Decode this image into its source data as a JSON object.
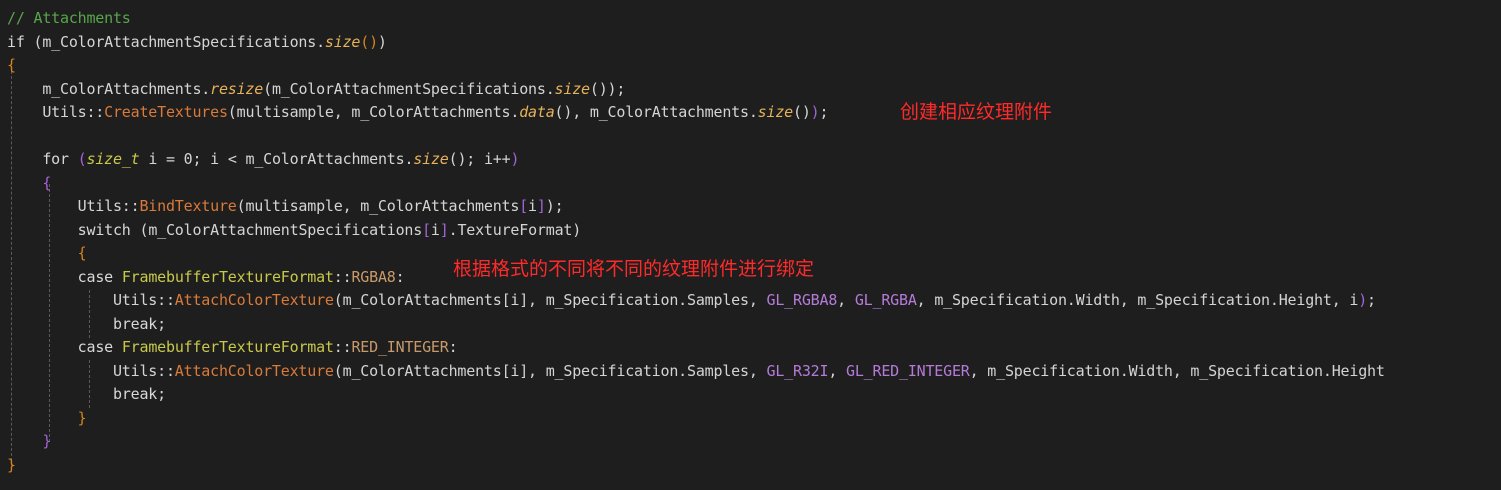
{
  "colors": {
    "background": "#1e1e1e",
    "text": "#d4d4d4",
    "comment": "#57a64a",
    "keyword": "#d8d8d8",
    "method": "#e8b25a",
    "function": "#d97a3a",
    "type": "#c8c84a",
    "macro": "#b57bd9",
    "enum_member": "#c89a6a",
    "bracket_purple": "#a463d6",
    "bracket_orange": "#d2851f",
    "annotation": "#ff2a2a",
    "guide": "#5a5a5a"
  },
  "code_lines": [
    [
      {
        "t": "// Attachments",
        "c": "comment"
      }
    ],
    [
      {
        "t": "if ",
        "c": "keyword"
      },
      {
        "t": "(m_ColorAttachmentSpecifications."
      },
      {
        "t": "size",
        "c": "method",
        "i": true
      },
      {
        "t": "()",
        "c": "bracket_orange"
      },
      {
        "t": ")"
      }
    ],
    [
      {
        "t": "{",
        "c": "bracket_orange"
      }
    ],
    [
      {
        "t": "    m_ColorAttachments."
      },
      {
        "t": "resize",
        "c": "method",
        "i": true
      },
      {
        "t": "("
      },
      {
        "t": "m_ColorAttachmentSpecifications."
      },
      {
        "t": "size",
        "c": "method",
        "i": true
      },
      {
        "t": "()"
      },
      {
        "t": ");"
      }
    ],
    [
      {
        "t": "    Utils::"
      },
      {
        "t": "CreateTextures",
        "c": "function"
      },
      {
        "t": "("
      },
      {
        "t": "multisample, m_ColorAttachments."
      },
      {
        "t": "data",
        "c": "method",
        "i": true
      },
      {
        "t": "()"
      },
      {
        "t": ", m_ColorAttachments."
      },
      {
        "t": "size",
        "c": "method",
        "i": true
      },
      {
        "t": "()"
      },
      {
        "t": ")",
        "c": "bracket_purple"
      },
      {
        "t": ";"
      }
    ],
    [],
    [
      {
        "t": "    "
      },
      {
        "t": "for",
        "c": "keyword"
      },
      {
        "t": " "
      },
      {
        "t": "(",
        "c": "bracket_purple"
      },
      {
        "t": "size_t",
        "c": "type",
        "i": true
      },
      {
        "t": " i = 0; i < m_ColorAttachments."
      },
      {
        "t": "size",
        "c": "method",
        "i": true
      },
      {
        "t": "()"
      },
      {
        "t": "; i++"
      },
      {
        "t": ")",
        "c": "bracket_purple"
      }
    ],
    [
      {
        "t": "    "
      },
      {
        "t": "{",
        "c": "bracket_purple"
      }
    ],
    [
      {
        "t": "        Utils::"
      },
      {
        "t": "BindTexture",
        "c": "function"
      },
      {
        "t": "(multisample, m_ColorAttachments"
      },
      {
        "t": "[",
        "c": "bracket_purple"
      },
      {
        "t": "i"
      },
      {
        "t": "]",
        "c": "bracket_purple"
      },
      {
        "t": ");"
      }
    ],
    [
      {
        "t": "        "
      },
      {
        "t": "switch",
        "c": "keyword"
      },
      {
        "t": " (m_ColorAttachmentSpecifications"
      },
      {
        "t": "[",
        "c": "bracket_purple"
      },
      {
        "t": "i"
      },
      {
        "t": "]",
        "c": "bracket_purple"
      },
      {
        "t": ".TextureFormat)"
      }
    ],
    [
      {
        "t": "        "
      },
      {
        "t": "{",
        "c": "bracket_orange"
      }
    ],
    [
      {
        "t": "        "
      },
      {
        "t": "case",
        "c": "keyword"
      },
      {
        "t": " "
      },
      {
        "t": "FramebufferTextureFormat",
        "c": "type"
      },
      {
        "t": "::"
      },
      {
        "t": "RGBA8",
        "c": "enum_member"
      },
      {
        "t": ":"
      }
    ],
    [
      {
        "t": "            Utils::"
      },
      {
        "t": "AttachColorTexture",
        "c": "function"
      },
      {
        "t": "("
      },
      {
        "t": "m_ColorAttachments[i], m_Specification.Samples, "
      },
      {
        "t": "GL_RGBA8",
        "c": "macro"
      },
      {
        "t": ", "
      },
      {
        "t": "GL_RGBA",
        "c": "macro"
      },
      {
        "t": ", m_Specification.Width, m_Specification.Height, i"
      },
      {
        "t": ")",
        "c": "bracket_purple"
      },
      {
        "t": ";"
      }
    ],
    [
      {
        "t": "            "
      },
      {
        "t": "break",
        "c": "keyword"
      },
      {
        "t": ";"
      }
    ],
    [
      {
        "t": "        "
      },
      {
        "t": "case",
        "c": "keyword"
      },
      {
        "t": " "
      },
      {
        "t": "FramebufferTextureFormat",
        "c": "type"
      },
      {
        "t": "::"
      },
      {
        "t": "RED_INTEGER",
        "c": "enum_member"
      },
      {
        "t": ":"
      }
    ],
    [
      {
        "t": "            Utils::"
      },
      {
        "t": "AttachColorTexture",
        "c": "function"
      },
      {
        "t": "("
      },
      {
        "t": "m_ColorAttachments[i], m_Specification.Samples, "
      },
      {
        "t": "GL_R32I",
        "c": "macro"
      },
      {
        "t": ", "
      },
      {
        "t": "GL_RED_INTEGER",
        "c": "macro"
      },
      {
        "t": ", m_Specification.Width, m_Specification.Height"
      }
    ],
    [
      {
        "t": "            "
      },
      {
        "t": "break",
        "c": "keyword"
      },
      {
        "t": ";"
      }
    ],
    [
      {
        "t": "        "
      },
      {
        "t": "}",
        "c": "bracket_orange"
      }
    ],
    [
      {
        "t": "    "
      },
      {
        "t": "}",
        "c": "bracket_purple"
      }
    ],
    [
      {
        "t": "}",
        "c": "bracket_orange"
      }
    ]
  ],
  "annotations": {
    "create_textures": "创建相应纹理附件",
    "bind_by_format": "根据格式的不同将不同的纹理附件进行绑定"
  }
}
